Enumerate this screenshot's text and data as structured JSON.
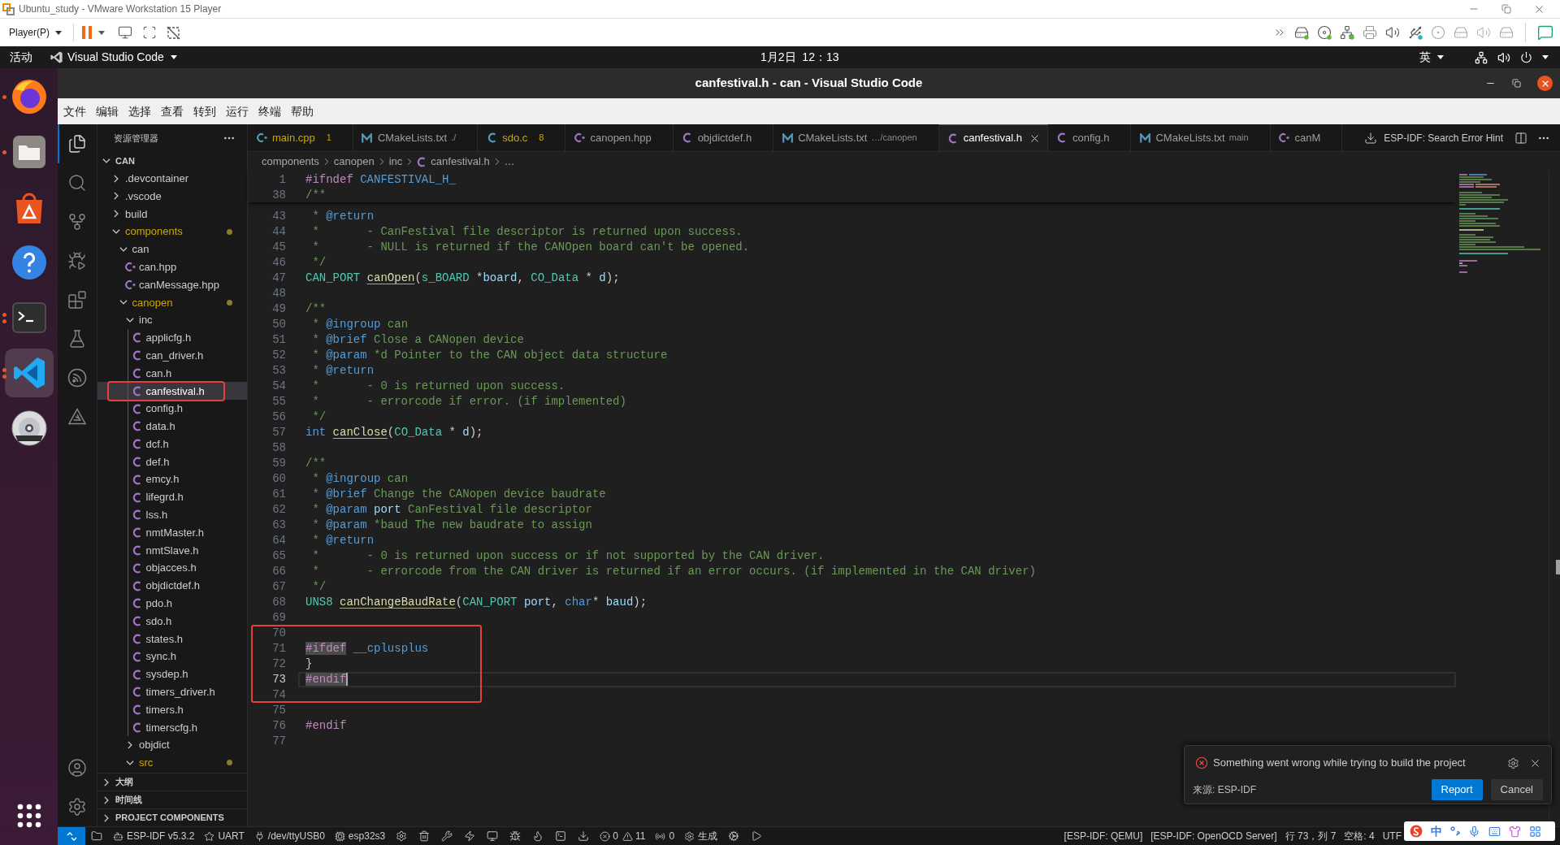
{
  "vm_window": {
    "title": "Ubuntu_study - VMware Workstation 15 Player",
    "player_menu": "Player(P)"
  },
  "top_bar": {
    "activities": "活动",
    "app_menu": "Visual Studio Code",
    "clock": "1月2日  12：13",
    "input_method": "英"
  },
  "dock": [
    {
      "kind": "browser",
      "running": true,
      "multiple_windows": false,
      "selected": false
    },
    {
      "kind": "files",
      "running": true,
      "multiple_windows": false,
      "selected": false
    },
    {
      "kind": "store",
      "running": false,
      "selected": false
    },
    {
      "kind": "help",
      "running": false,
      "selected": false
    },
    {
      "kind": "terminal",
      "running": true,
      "multiple_windows": true,
      "selected": false
    },
    {
      "kind": "editor",
      "running": true,
      "multiple_windows": true,
      "selected": true
    },
    {
      "kind": "disc",
      "running": false,
      "selected": false
    }
  ],
  "vscode": {
    "title": "canfestival.h - can - Visual Studio Code",
    "menu": [
      "文件",
      "编辑",
      "选择",
      "查看",
      "转到",
      "运行",
      "终端",
      "帮助"
    ],
    "activity_bar": [
      {
        "kind": "explorer",
        "selected": true
      },
      {
        "kind": "search",
        "selected": false
      },
      {
        "kind": "scm",
        "selected": false
      },
      {
        "kind": "debug",
        "selected": false
      },
      {
        "kind": "extensions",
        "selected": false
      },
      {
        "kind": "testing",
        "selected": false
      },
      {
        "kind": "espressif",
        "selected": false
      },
      {
        "kind": "idf",
        "selected": false
      }
    ],
    "activity_bottom": [
      {
        "kind": "account"
      },
      {
        "kind": "settings"
      }
    ],
    "explorer": {
      "title": "资源管理器",
      "root": {
        "label": "CAN",
        "expanded": true
      },
      "tree": [
        {
          "label": ".devcontainer",
          "kind": "folder",
          "expanded": false,
          "selected": false,
          "warning": false
        },
        {
          "label": ".vscode",
          "kind": "folder",
          "expanded": false,
          "selected": false,
          "warning": false
        },
        {
          "label": "build",
          "kind": "folder",
          "expanded": false,
          "selected": false,
          "warning": false
        },
        {
          "label": "components",
          "kind": "folder",
          "expanded": true,
          "selected": false,
          "warning": true,
          "children": [
            {
              "label": "can",
              "kind": "folder",
              "expanded": true,
              "selected": false,
              "warning": false,
              "children": [
                {
                  "label": "can.hpp",
                  "kind": "hpp",
                  "selected": false,
                  "warning": false
                },
                {
                  "label": "canMessage.hpp",
                  "kind": "hpp",
                  "selected": false,
                  "warning": false
                }
              ]
            },
            {
              "label": "canopen",
              "kind": "folder",
              "expanded": true,
              "selected": false,
              "warning": true,
              "children": [
                {
                  "label": "inc",
                  "kind": "folder",
                  "expanded": true,
                  "selected": false,
                  "warning": false,
                  "children": [
                    {
                      "label": "applicfg.h",
                      "kind": "h",
                      "selected": false,
                      "warning": false
                    },
                    {
                      "label": "can_driver.h",
                      "kind": "h",
                      "selected": false,
                      "warning": false
                    },
                    {
                      "label": "can.h",
                      "kind": "h",
                      "selected": false,
                      "warning": false
                    },
                    {
                      "label": "canfestival.h",
                      "kind": "h",
                      "selected": true,
                      "warning": false
                    },
                    {
                      "label": "config.h",
                      "kind": "h",
                      "selected": false,
                      "warning": false
                    },
                    {
                      "label": "data.h",
                      "kind": "h",
                      "selected": false,
                      "warning": false
                    },
                    {
                      "label": "dcf.h",
                      "kind": "h",
                      "selected": false,
                      "warning": false
                    },
                    {
                      "label": "def.h",
                      "kind": "h",
                      "selected": false,
                      "warning": false
                    },
                    {
                      "label": "emcy.h",
                      "kind": "h",
                      "selected": false,
                      "warning": false
                    },
                    {
                      "label": "lifegrd.h",
                      "kind": "h",
                      "selected": false,
                      "warning": false
                    },
                    {
                      "label": "lss.h",
                      "kind": "h",
                      "selected": false,
                      "warning": false
                    },
                    {
                      "label": "nmtMaster.h",
                      "kind": "h",
                      "selected": false,
                      "warning": false
                    },
                    {
                      "label": "nmtSlave.h",
                      "kind": "h",
                      "selected": false,
                      "warning": false
                    },
                    {
                      "label": "objacces.h",
                      "kind": "h",
                      "selected": false,
                      "warning": false
                    },
                    {
                      "label": "objdictdef.h",
                      "kind": "h",
                      "selected": false,
                      "warning": false
                    },
                    {
                      "label": "pdo.h",
                      "kind": "h",
                      "selected": false,
                      "warning": false
                    },
                    {
                      "label": "sdo.h",
                      "kind": "h",
                      "selected": false,
                      "warning": false
                    },
                    {
                      "label": "states.h",
                      "kind": "h",
                      "selected": false,
                      "warning": false
                    },
                    {
                      "label": "sync.h",
                      "kind": "h",
                      "selected": false,
                      "warning": false
                    },
                    {
                      "label": "sysdep.h",
                      "kind": "h",
                      "selected": false,
                      "warning": false
                    },
                    {
                      "label": "timers_driver.h",
                      "kind": "h",
                      "selected": false,
                      "warning": false
                    },
                    {
                      "label": "timers.h",
                      "kind": "h",
                      "selected": false,
                      "warning": false
                    },
                    {
                      "label": "timerscfg.h",
                      "kind": "h",
                      "selected": false,
                      "warning": false
                    }
                  ]
                },
                {
                  "label": "objdict",
                  "kind": "folder",
                  "expanded": false,
                  "selected": false,
                  "warning": false
                },
                {
                  "label": "src",
                  "kind": "folder",
                  "expanded": true,
                  "selected": false,
                  "warning": true
                }
              ]
            }
          ]
        }
      ],
      "sections": [
        {
          "label": "大纲",
          "expanded": false
        },
        {
          "label": "时间线",
          "expanded": false
        },
        {
          "label": "PROJECT COMPONENTS",
          "expanded": false
        }
      ]
    },
    "tabs": [
      {
        "label": "main.cpp",
        "kind": "cpp",
        "badge": "1",
        "warning": true,
        "selected": false
      },
      {
        "label": "CMakeLists.txt",
        "kind": "cmake",
        "description": "./",
        "warning": false,
        "selected": false
      },
      {
        "label": "sdo.c",
        "kind": "c",
        "badge": "8",
        "warning": true,
        "selected": false
      },
      {
        "label": "canopen.hpp",
        "kind": "hpp",
        "warning": false,
        "selected": false
      },
      {
        "label": "objdictdef.h",
        "kind": "h",
        "warning": false,
        "selected": false
      },
      {
        "label": "CMakeLists.txt",
        "kind": "cmake",
        "description": "…/canopen",
        "warning": false,
        "selected": false
      },
      {
        "label": "canfestival.h",
        "kind": "h",
        "warning": false,
        "selected": true
      },
      {
        "label": "config.h",
        "kind": "h",
        "warning": false,
        "selected": false
      },
      {
        "label": "CMakeLists.txt",
        "kind": "cmake",
        "description": "main",
        "warning": false,
        "selected": false
      },
      {
        "label": "canM",
        "kind": "hpp",
        "warning": false,
        "selected": false
      }
    ],
    "editor_hint": "ESP-IDF: Search Error Hint",
    "breadcrumb": [
      {
        "label": "components",
        "kind": "folder"
      },
      {
        "label": "canopen",
        "kind": "folder"
      },
      {
        "label": "inc",
        "kind": "folder"
      },
      {
        "label": "canfestival.h",
        "kind": "h"
      },
      {
        "label": "…",
        "kind": "symbol"
      }
    ],
    "editor": {
      "sticky": [
        {
          "number": "1",
          "tokens": [
            {
              "text": "#ifndef",
              "kind": "directive"
            },
            {
              "text": " CANFESTIVAL_H_",
              "kind": "macro"
            }
          ]
        },
        {
          "number": "38",
          "tokens": [
            {
              "text": "/**",
              "kind": "comment"
            }
          ]
        }
      ],
      "lines": [
        {
          "number": "43",
          "current": false,
          "tokens": [
            {
              "text": " * ",
              "kind": "comment"
            },
            {
              "text": "@return",
              "kind": "tag"
            }
          ]
        },
        {
          "number": "44",
          "current": false,
          "tokens": [
            {
              "text": " *       - CanFestival file descriptor is returned upon success.",
              "kind": "comment"
            }
          ]
        },
        {
          "number": "45",
          "current": false,
          "tokens": [
            {
              "text": " *       - NULL is returned if the CANOpen board can't be opened.",
              "kind": "comment"
            }
          ]
        },
        {
          "number": "46",
          "current": false,
          "tokens": [
            {
              "text": " */",
              "kind": "comment"
            }
          ]
        },
        {
          "number": "47",
          "current": false,
          "tokens": [
            {
              "text": "CAN_PORT ",
              "kind": "type"
            },
            {
              "text": "canOpen",
              "kind": "function"
            },
            {
              "text": "(",
              "kind": "plain"
            },
            {
              "text": "s_BOARD",
              "kind": "type"
            },
            {
              "text": " *",
              "kind": "plain"
            },
            {
              "text": "board",
              "kind": "parameter"
            },
            {
              "text": ", ",
              "kind": "plain"
            },
            {
              "text": "CO_Data",
              "kind": "type"
            },
            {
              "text": " * ",
              "kind": "plain"
            },
            {
              "text": "d",
              "kind": "parameter"
            },
            {
              "text": ");",
              "kind": "plain"
            }
          ]
        },
        {
          "number": "48",
          "current": false
        },
        {
          "number": "49",
          "current": false,
          "tokens": [
            {
              "text": "/**",
              "kind": "comment"
            }
          ]
        },
        {
          "number": "50",
          "current": false,
          "tokens": [
            {
              "text": " * ",
              "kind": "comment"
            },
            {
              "text": "@ingroup",
              "kind": "tag"
            },
            {
              "text": " can",
              "kind": "comment"
            }
          ]
        },
        {
          "number": "51",
          "current": false,
          "tokens": [
            {
              "text": " * ",
              "kind": "comment"
            },
            {
              "text": "@brief",
              "kind": "tag"
            },
            {
              "text": " Close a CANopen device",
              "kind": "comment"
            }
          ]
        },
        {
          "number": "52",
          "current": false,
          "tokens": [
            {
              "text": " * ",
              "kind": "comment"
            },
            {
              "text": "@param",
              "kind": "tag"
            },
            {
              "text": " *d Pointer to the CAN object data structure",
              "kind": "comment"
            }
          ]
        },
        {
          "number": "53",
          "current": false,
          "tokens": [
            {
              "text": " * ",
              "kind": "comment"
            },
            {
              "text": "@return",
              "kind": "tag"
            }
          ]
        },
        {
          "number": "54",
          "current": false,
          "tokens": [
            {
              "text": " *       - 0 is returned upon success.",
              "kind": "comment"
            }
          ]
        },
        {
          "number": "55",
          "current": false,
          "tokens": [
            {
              "text": " *       - errorcode if error. (if implemented)",
              "kind": "comment"
            }
          ]
        },
        {
          "number": "56",
          "current": false,
          "tokens": [
            {
              "text": " */",
              "kind": "comment"
            }
          ]
        },
        {
          "number": "57",
          "current": false,
          "tokens": [
            {
              "text": "int ",
              "kind": "keyword"
            },
            {
              "text": "canClose",
              "kind": "function"
            },
            {
              "text": "(",
              "kind": "plain"
            },
            {
              "text": "CO_Data",
              "kind": "type"
            },
            {
              "text": " * ",
              "kind": "plain"
            },
            {
              "text": "d",
              "kind": "parameter"
            },
            {
              "text": ");",
              "kind": "plain"
            }
          ]
        },
        {
          "number": "58",
          "current": false
        },
        {
          "number": "59",
          "current": false,
          "tokens": [
            {
              "text": "/**",
              "kind": "comment"
            }
          ]
        },
        {
          "number": "60",
          "current": false,
          "tokens": [
            {
              "text": " * ",
              "kind": "comment"
            },
            {
              "text": "@ingroup",
              "kind": "tag"
            },
            {
              "text": " can",
              "kind": "comment"
            }
          ]
        },
        {
          "number": "61",
          "current": false,
          "tokens": [
            {
              "text": " * ",
              "kind": "comment"
            },
            {
              "text": "@brief",
              "kind": "tag"
            },
            {
              "text": " Change the CANopen device baudrate",
              "kind": "comment"
            }
          ]
        },
        {
          "number": "62",
          "current": false,
          "tokens": [
            {
              "text": " * ",
              "kind": "comment"
            },
            {
              "text": "@param ",
              "kind": "tag"
            },
            {
              "text": "port",
              "kind": "docparam"
            },
            {
              "text": " CanFestival file descriptor",
              "kind": "comment"
            }
          ]
        },
        {
          "number": "63",
          "current": false,
          "tokens": [
            {
              "text": " * ",
              "kind": "comment"
            },
            {
              "text": "@param",
              "kind": "tag"
            },
            {
              "text": " *baud The new baudrate to assign",
              "kind": "comment"
            }
          ]
        },
        {
          "number": "64",
          "current": false,
          "tokens": [
            {
              "text": " * ",
              "kind": "comment"
            },
            {
              "text": "@return",
              "kind": "tag"
            }
          ]
        },
        {
          "number": "65",
          "current": false,
          "tokens": [
            {
              "text": " *       - 0 is returned upon success or if not supported by the CAN driver.",
              "kind": "comment"
            }
          ]
        },
        {
          "number": "66",
          "current": false,
          "tokens": [
            {
              "text": " *       - errorcode from the CAN driver is returned if an error occurs. (if implemented in the CAN driver)",
              "kind": "comment"
            }
          ]
        },
        {
          "number": "67",
          "current": false,
          "tokens": [
            {
              "text": " */",
              "kind": "comment"
            }
          ]
        },
        {
          "number": "68",
          "current": false,
          "tokens": [
            {
              "text": "UNS8 ",
              "kind": "type"
            },
            {
              "text": "canChangeBaudRate",
              "kind": "function"
            },
            {
              "text": "(",
              "kind": "plain"
            },
            {
              "text": "CAN_PORT ",
              "kind": "type"
            },
            {
              "text": "port",
              "kind": "parameter"
            },
            {
              "text": ", ",
              "kind": "plain"
            },
            {
              "text": "char",
              "kind": "keyword"
            },
            {
              "text": "* ",
              "kind": "plain"
            },
            {
              "text": "baud",
              "kind": "parameter"
            },
            {
              "text": ");",
              "kind": "plain"
            }
          ]
        },
        {
          "number": "69",
          "current": false
        },
        {
          "number": "70",
          "current": false
        },
        {
          "number": "71",
          "current": false,
          "tokens": [
            {
              "text": "#ifdef",
              "kind": "match"
            },
            {
              "text": " __cplusplus",
              "kind": "macro"
            }
          ]
        },
        {
          "number": "72",
          "current": false,
          "tokens": [
            {
              "text": "}",
              "kind": "plain"
            }
          ]
        },
        {
          "number": "73",
          "current": true,
          "tokens": [
            {
              "text": "#endif",
              "kind": "match"
            }
          ]
        },
        {
          "number": "74",
          "current": false
        },
        {
          "number": "75",
          "current": false
        },
        {
          "number": "76",
          "current": false,
          "tokens": [
            {
              "text": "#endif",
              "kind": "directive"
            }
          ]
        },
        {
          "number": "77",
          "current": false
        }
      ]
    },
    "notification": {
      "message": "Something went wrong while trying to build the project",
      "source": "来源: ESP-IDF",
      "buttons": [
        {
          "label": "Report",
          "primary": true
        },
        {
          "label": "Cancel",
          "primary": false
        }
      ]
    },
    "status_bar": {
      "left": [
        {
          "kind": "remote"
        },
        {
          "kind": "folder"
        },
        {
          "kind": "version",
          "text": "ESP-IDF v5.3.2"
        },
        {
          "kind": "star",
          "text": "UART"
        },
        {
          "kind": "port",
          "text": "/dev/ttyUSB0"
        },
        {
          "kind": "chip",
          "text": "esp32s3"
        },
        {
          "kind": "gear"
        },
        {
          "kind": "trash"
        },
        {
          "kind": "wrench"
        },
        {
          "kind": "flash"
        },
        {
          "kind": "monitor"
        },
        {
          "kind": "debug"
        },
        {
          "kind": "flame"
        },
        {
          "kind": "terminal"
        },
        {
          "kind": "download"
        },
        {
          "kind": "problems",
          "errors": "0",
          "warnings": "11"
        },
        {
          "kind": "ports",
          "text": "0"
        },
        {
          "kind": "build",
          "text": "生成"
        },
        {
          "kind": "cog"
        },
        {
          "kind": "run"
        }
      ],
      "right": [
        "[ESP-IDF: QEMU]",
        "[ESP-IDF: OpenOCD Server]",
        "行 73，列 7",
        "空格: 4",
        "UTF"
      ]
    }
  },
  "ime_toolbar": {
    "mode": "中"
  }
}
